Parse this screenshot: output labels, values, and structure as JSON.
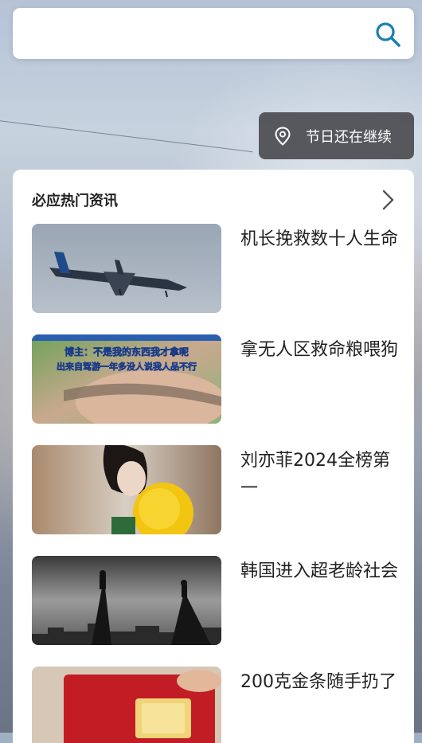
{
  "search": {
    "placeholder": "",
    "icon": "search-icon"
  },
  "location_chip": {
    "icon": "location-pin-icon",
    "label": "节日还在继续"
  },
  "news_card": {
    "title": "必应热门资讯",
    "more_icon": "chevron-right-icon",
    "items": [
      {
        "title": "机长挽救数十人生命",
        "thumb_icon": "airplane-image"
      },
      {
        "title": "拿无人区救命粮喂狗",
        "thumb_icon": "video-screenshot-image",
        "thumb_caption_line1": "博主：不是我的东西我才拿呢",
        "thumb_caption_line2": "出来自驾游一年多没人说我人品不行"
      },
      {
        "title": "刘亦菲2024全榜第一",
        "thumb_icon": "portrait-flowers-image"
      },
      {
        "title": "韩国进入超老龄社会",
        "thumb_icon": "silhouette-city-image"
      },
      {
        "title": "200克金条随手扔了",
        "thumb_icon": "gold-bar-image"
      }
    ]
  },
  "colors": {
    "accent": "#1a7fb5",
    "chip_bg": "#3a3a3e",
    "text_primary": "#222222"
  }
}
